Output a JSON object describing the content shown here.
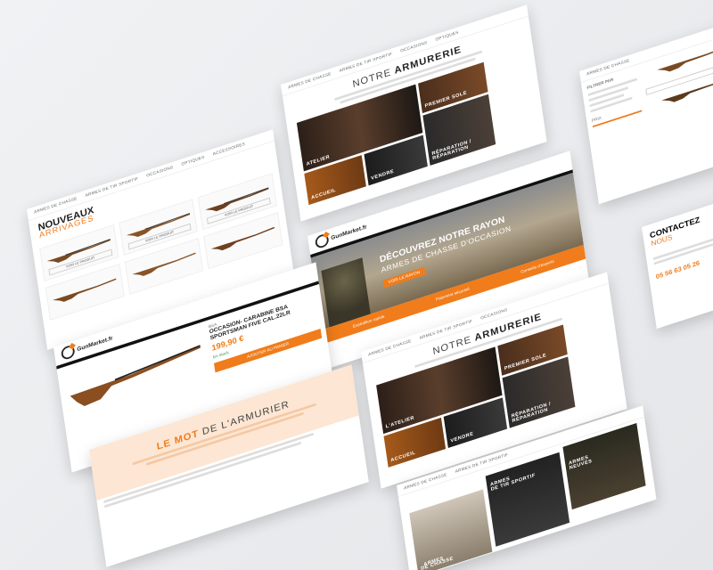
{
  "brand": {
    "name": "GunMarket.fr"
  },
  "colors": {
    "accent": "#f07c1b",
    "dark": "#111111"
  },
  "nouveaux": {
    "title_bold": "NOUVEAUX",
    "title_thin": "ARRIVAGES",
    "nav": [
      "ARMES DE CHASSE",
      "ARMES DE TIR SPORTIF",
      "OCCASIONS",
      "OPTIQUES",
      "ACCESSOIRES"
    ],
    "btn": "VOIR LE PRODUIT"
  },
  "armurerie_top": {
    "title_thin": "NOTRE",
    "title_bold": "ARMURERIE",
    "tiles": [
      "ATELIER",
      "PREMIER SOLE",
      "ACCUEIL",
      "VENDRE",
      "RÉPARATION / RÉPARATION"
    ]
  },
  "hero": {
    "heading": "DÉCOUVREZ NOTRE RAYON",
    "sub": "ARMES DE CHASSE D'OCCASION",
    "nav": [
      "ARMES DE CHASSE",
      "ARMES DE TIR SPORTIF",
      "OCCASIONS",
      "OPTIQUES",
      "ACCESSOIRES",
      "ARMES NEUVES"
    ],
    "cta": "VOIR LE RAYON",
    "features": [
      "Expédition rapide",
      "Paiement sécurisé",
      "Conseils d'experts"
    ]
  },
  "product": {
    "brand": "BSA",
    "title": "OCCASION- CARABINE BSA SPORTSMAN FIVE CAL.22LR",
    "price": "199,90 €",
    "cta": "AJOUTER AU PANIER",
    "stock": "En stock"
  },
  "mot": {
    "title_bold": "LE MOT",
    "title_thin": "DE L'ARMURIER"
  },
  "armurerie_bottom": {
    "title_thin": "NOTRE",
    "title_bold": "ARMURERIE",
    "tiles": [
      "L'ATELIER",
      "PREMIER SOLE",
      "ACCUEIL",
      "VENDRE",
      "RÉPARATION / RÉPARATION"
    ]
  },
  "categories": {
    "tir": [
      "ARMES",
      "DE TIR SPORTIF"
    ],
    "neuves": [
      "ARMES",
      "NEUVES"
    ],
    "chasse": [
      "ARMES",
      "DE CHASSE"
    ]
  },
  "filters": {
    "title": "FILTRER PAR",
    "price": "PRIX"
  },
  "contact": {
    "title_bold": "CONTACTEZ",
    "title_thin": "NOUS",
    "phone": "05 56 63 05 26"
  }
}
